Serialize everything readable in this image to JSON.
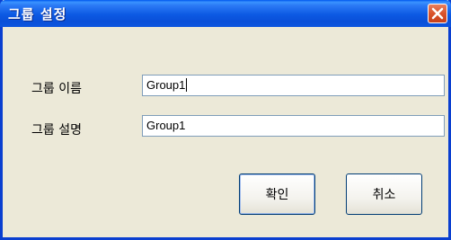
{
  "dialog": {
    "title": "그룹 설정",
    "close_icon": "close-x-icon"
  },
  "form": {
    "name_label": "그룹 이름",
    "name_value": "Group1",
    "description_label": "그룹 설명",
    "description_value": "Group1"
  },
  "buttons": {
    "ok_label": "확인",
    "cancel_label": "취소"
  },
  "colors": {
    "titlebar": "#0a4fd8",
    "window_bg": "#ece9d8",
    "close_button": "#d9532c"
  }
}
